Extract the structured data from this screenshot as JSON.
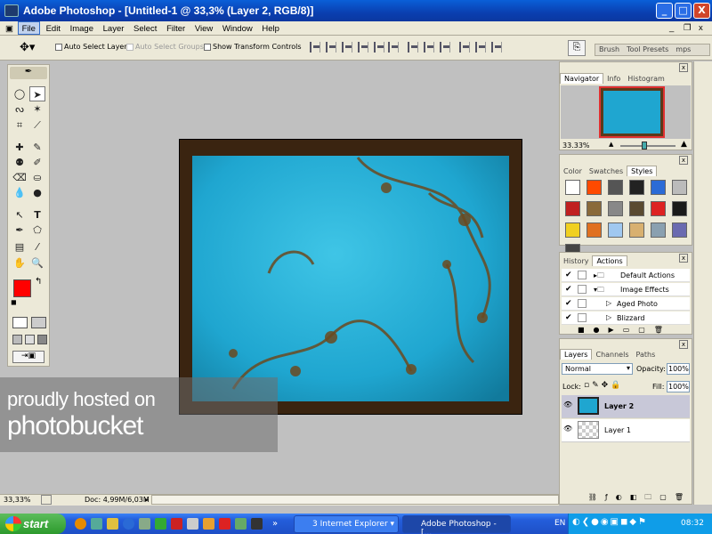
{
  "window": {
    "title": "Adobe Photoshop - [Untitled-1 @ 33,3% (Layer 2, RGB/8)]",
    "min": "_",
    "max": "□",
    "close": "X",
    "doc_min": "_",
    "doc_restore": "❐",
    "doc_close": "x"
  },
  "menu": [
    "File",
    "Edit",
    "Image",
    "Layer",
    "Select",
    "Filter",
    "View",
    "Window",
    "Help"
  ],
  "options": {
    "auto_select_layer": "Auto Select Layer",
    "auto_select_groups": "Auto Select Groups",
    "show_transform": "Show Transform Controls",
    "tabs": [
      "Brush",
      "Tool Presets",
      "mps"
    ]
  },
  "canvas": {
    "watermark_line1": "proudly hosted on",
    "watermark_line2": "photobucket"
  },
  "status": {
    "zoom": "33,33%",
    "doc": "Doc: 4,99M/6,03M"
  },
  "navigator": {
    "tabs": [
      "Navigator",
      "Info",
      "Histogram"
    ],
    "zoom": "33.33%"
  },
  "swatches": {
    "tabs": [
      "Color",
      "Swatches",
      "Styles"
    ],
    "colors": [
      "#fff",
      "#ff4a00",
      "#555",
      "#222",
      "#2b6bd6",
      "#bbb",
      "#c02020",
      "#8a6a3a",
      "#888",
      "#5a4a30",
      "#d22",
      "#1a1a1a",
      "#f0d020",
      "#e07020",
      "#a0c8f0",
      "#d8b070",
      "#8aa0b0",
      "#6a6ab0",
      "#444"
    ]
  },
  "actions": {
    "tabs": [
      "History",
      "Actions"
    ],
    "rows": [
      "Default Actions",
      "Image Effects",
      "Aged Photo",
      "Blizzard"
    ],
    "check": "✔"
  },
  "layers": {
    "tabs": [
      "Layers",
      "Channels",
      "Paths"
    ],
    "blend": "Normal",
    "opacity_label": "Opacity:",
    "opacity": "100%",
    "lock_label": "Lock:",
    "fill_label": "Fill:",
    "fill": "100%",
    "items": [
      "Layer 2",
      "Layer 1"
    ],
    "eye": "👁"
  },
  "taskbar": {
    "start": "start",
    "items": [
      "3 Internet Explorer",
      "Adobe Photoshop - [..."
    ],
    "lang": "EN",
    "time": "08:32"
  }
}
